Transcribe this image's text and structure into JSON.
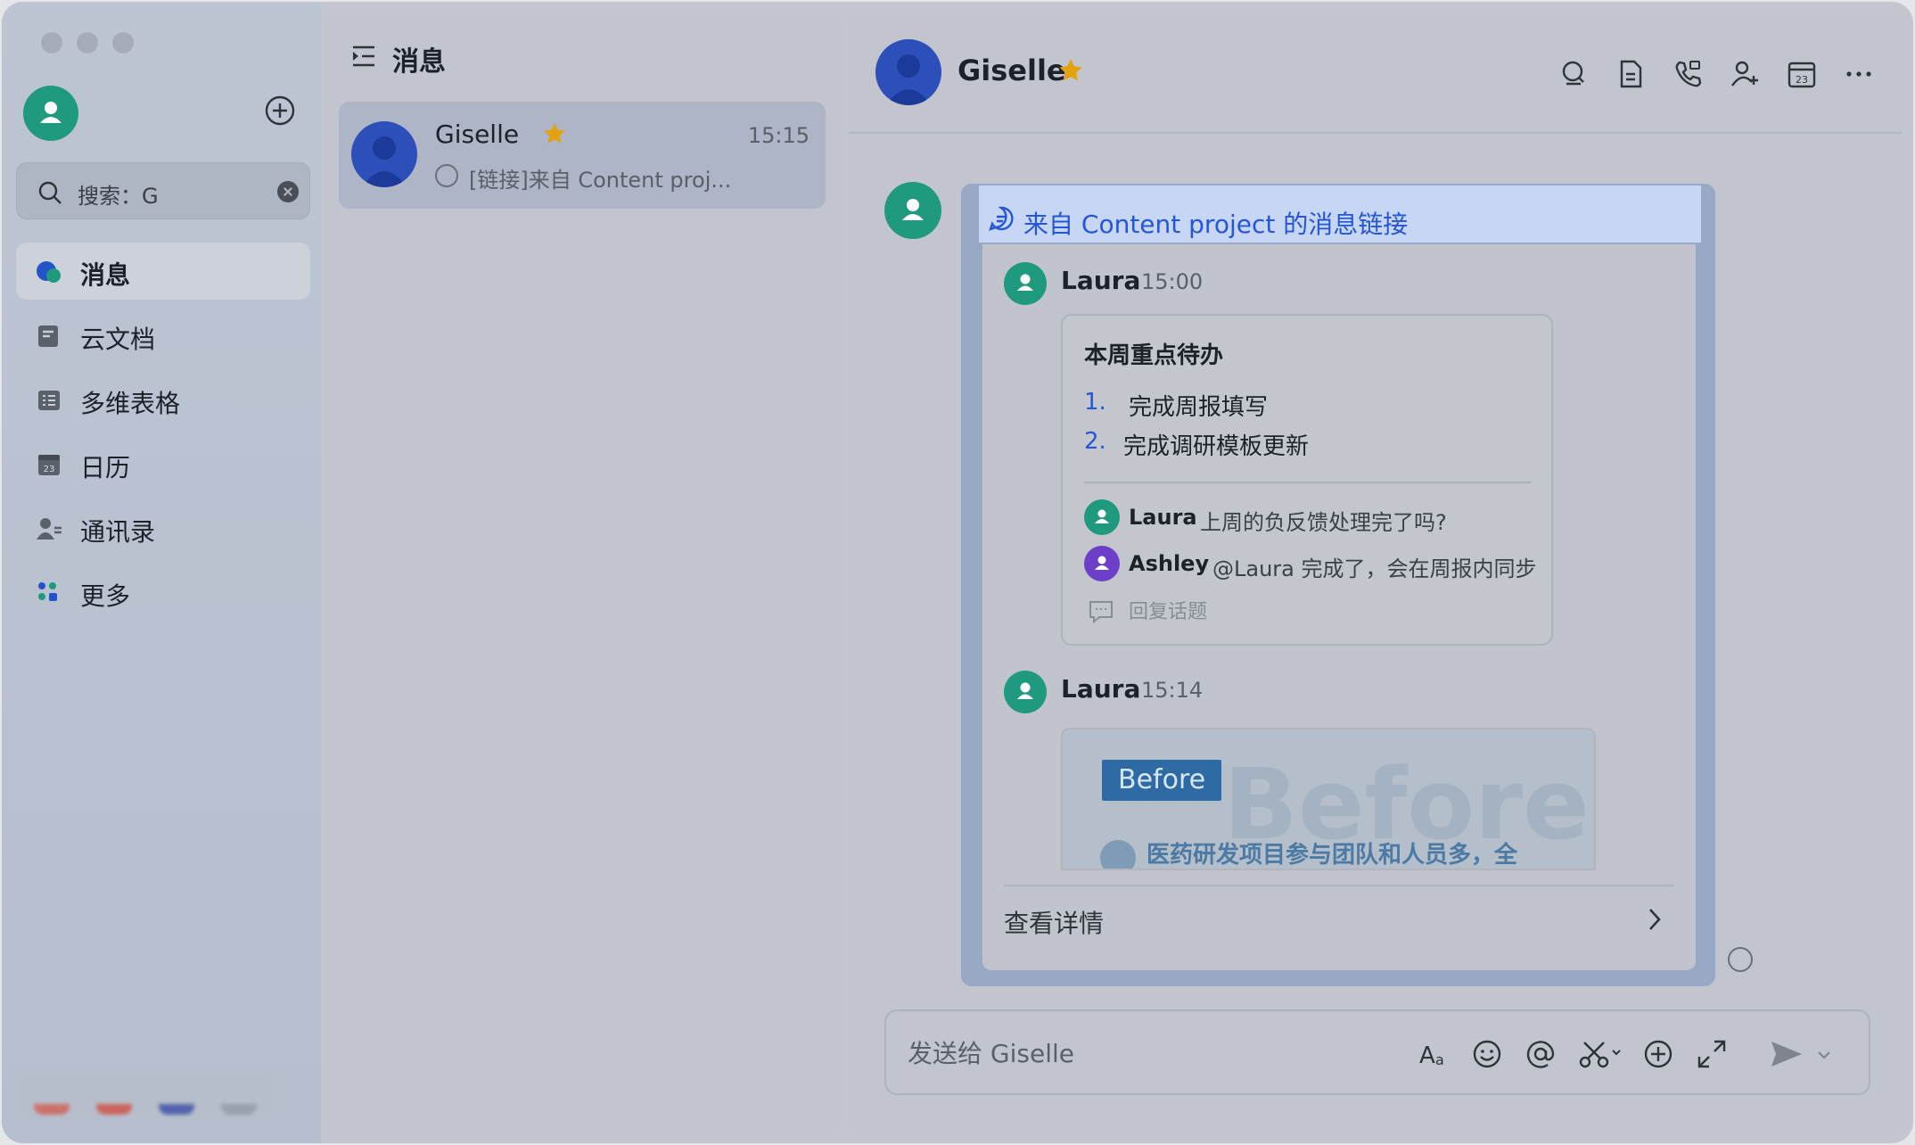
{
  "sidebar": {
    "search_text": "搜索：G",
    "items": [
      {
        "label": "消息",
        "icon": "message-icon"
      },
      {
        "label": "云文档",
        "icon": "docs-icon"
      },
      {
        "label": "多维表格",
        "icon": "table-icon"
      },
      {
        "label": "日历",
        "icon": "calendar-icon"
      },
      {
        "label": "通讯录",
        "icon": "contacts-icon"
      },
      {
        "label": "更多",
        "icon": "more-apps-icon"
      }
    ]
  },
  "list": {
    "title": "消息",
    "conversation": {
      "name": "Giselle",
      "time": "15:15",
      "preview": "[链接]来自 Content proj..."
    }
  },
  "chat": {
    "name": "Giselle",
    "forward_title": "来自 Content project 的消息链接",
    "message1": {
      "sender": "Laura",
      "time": "15:00",
      "todo_title": "本周重点待办",
      "todo_items": [
        {
          "num": "1.",
          "text": "完成周报填写"
        },
        {
          "num": "2.",
          "text": "完成调研模板更新"
        }
      ],
      "replies": [
        {
          "name": "Laura",
          "text": "上周的负反馈处理完了吗?",
          "color": "#1f9a7e"
        },
        {
          "name": "Ashley",
          "text": "@Laura 完成了，会在周报内同步",
          "color": "#6b3fc7"
        }
      ],
      "reply_label": "回复话题"
    },
    "message2": {
      "sender": "Laura",
      "time": "15:14",
      "image_badge": "Before",
      "image_ghost": "Before",
      "image_line": "医药研发项目参与团队和人员多，全"
    },
    "view_details": "查看详情",
    "composer_placeholder": "发送给 Giselle"
  },
  "colors": {
    "accent": "#2456d6",
    "avatar_green": "#1f9a7e",
    "avatar_blue": "#2c4fb9",
    "star": "#e3a20f"
  }
}
